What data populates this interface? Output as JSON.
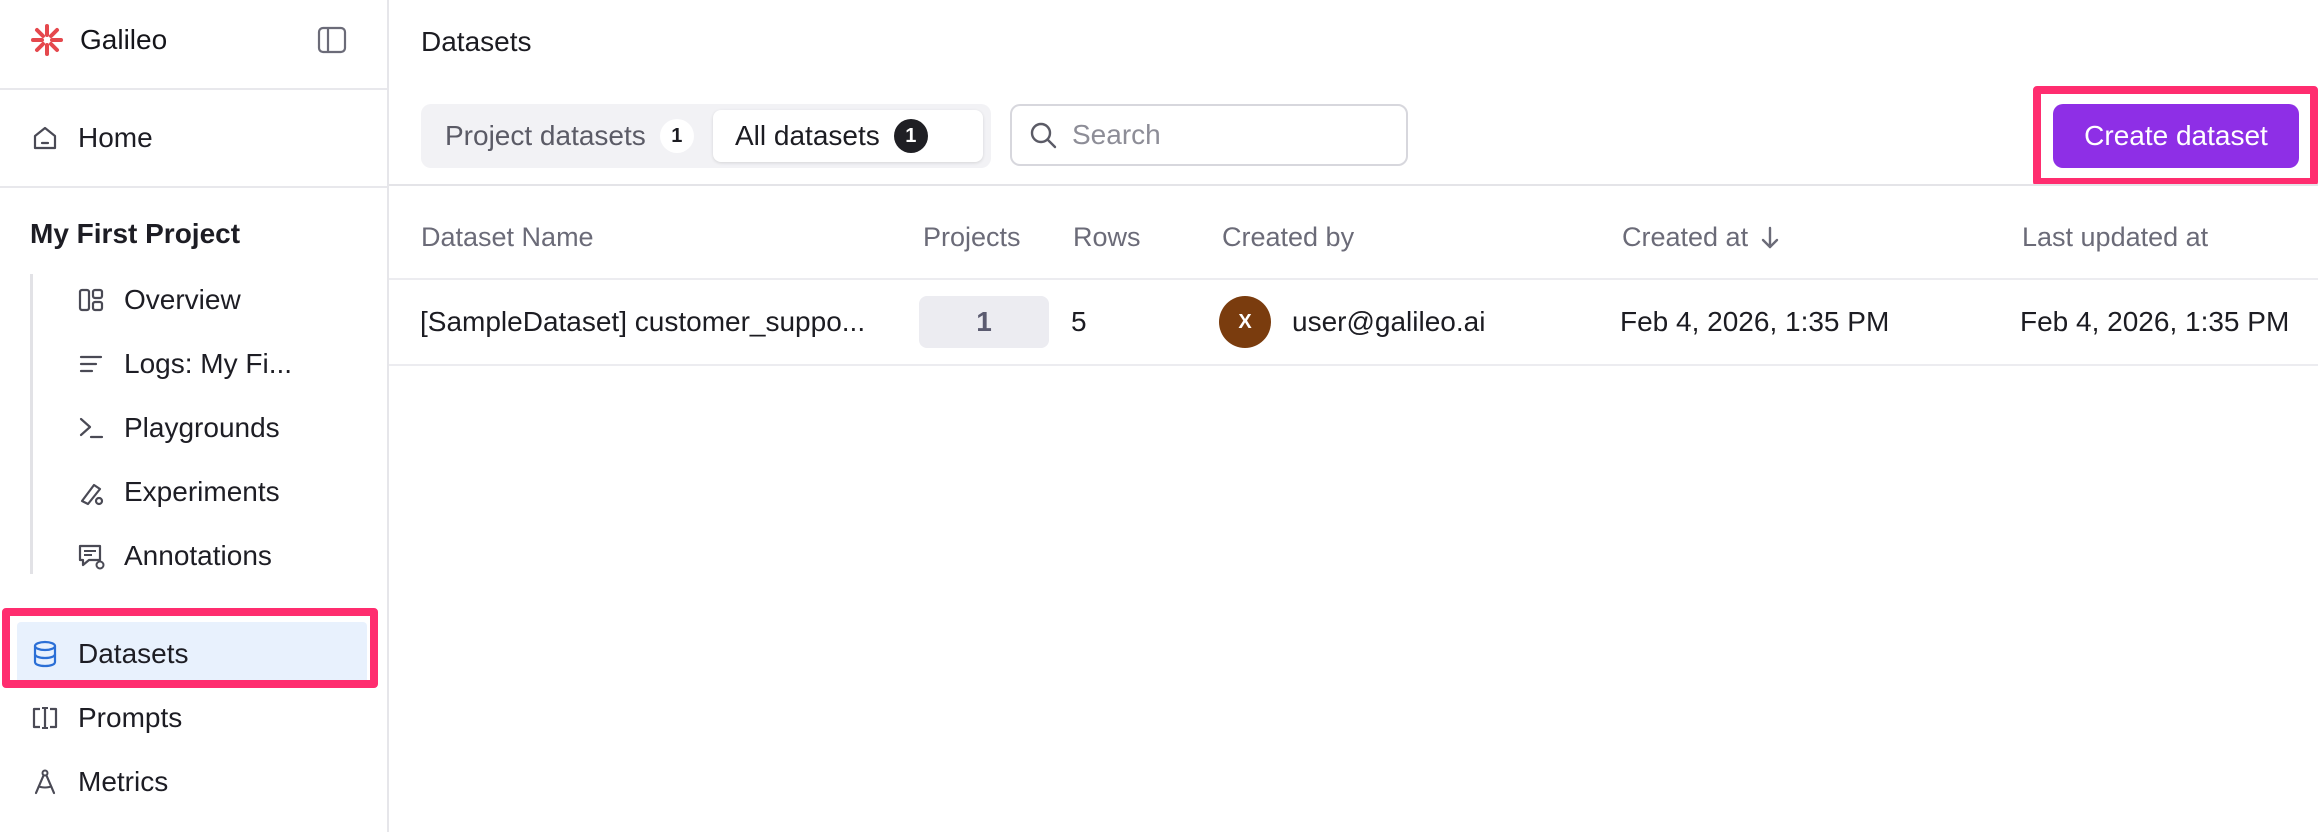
{
  "brand": {
    "name": "Galileo",
    "logo_icon": "galileo-logo-icon",
    "accent": "#e5484d"
  },
  "sidebar": {
    "home_label": "Home",
    "project_title": "My First Project",
    "project_items": [
      {
        "label": "Overview",
        "icon": "overview-icon"
      },
      {
        "label": "Logs: My Fi...",
        "icon": "logs-icon"
      },
      {
        "label": "Playgrounds",
        "icon": "playground-icon"
      },
      {
        "label": "Experiments",
        "icon": "experiment-icon"
      },
      {
        "label": "Annotations",
        "icon": "annotation-icon"
      }
    ],
    "global_items": [
      {
        "label": "Datasets",
        "icon": "database-icon",
        "active": true
      },
      {
        "label": "Prompts",
        "icon": "prompt-icon"
      },
      {
        "label": "Metrics",
        "icon": "metrics-icon"
      }
    ],
    "active_color": "#e8f1fd",
    "highlight_color": "#ff2d6f"
  },
  "page": {
    "title": "Datasets"
  },
  "tabs": [
    {
      "label": "Project datasets",
      "count": "1",
      "active": false
    },
    {
      "label": "All datasets",
      "count": "1",
      "active": true
    }
  ],
  "search": {
    "placeholder": "Search",
    "value": ""
  },
  "actions": {
    "create_label": "Create dataset",
    "create_color": "#8e2fe6"
  },
  "table": {
    "columns": [
      "Dataset Name",
      "Projects",
      "Rows",
      "Created by",
      "Created at",
      "Last updated at"
    ],
    "sorted_column": "Created at",
    "sort_direction": "descending",
    "rows": [
      {
        "name": "[SampleDataset] customer_suppo...",
        "projects": "1",
        "rows": "5",
        "avatar_initial": "X",
        "avatar_color": "#7a3c0e",
        "created_by": "user@galileo.ai",
        "created_at": "Feb 4, 2026, 1:35 PM",
        "updated_at": "Feb 4, 2026, 1:35 PM"
      }
    ]
  }
}
